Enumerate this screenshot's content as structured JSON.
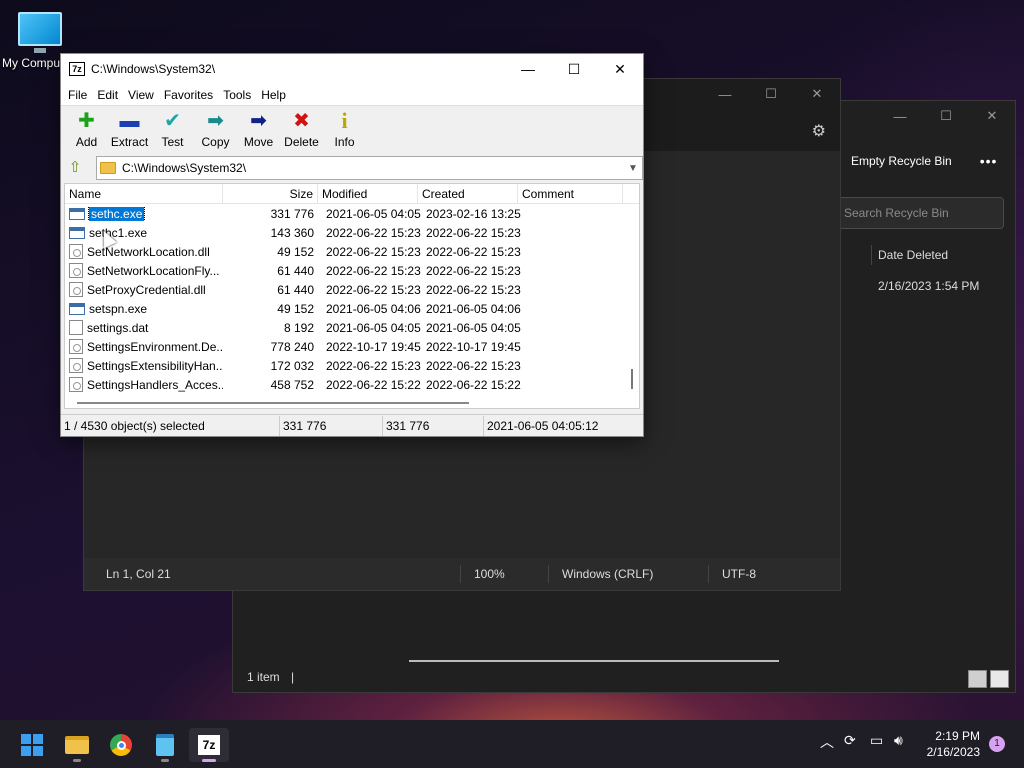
{
  "desktop": {
    "icon_label": "My Computer"
  },
  "recycle_bin": {
    "empty_label": "Empty Recycle Bin",
    "more_label": "•••",
    "search_placeholder": "Search Recycle Bin",
    "column_date_deleted": "Date Deleted",
    "date_value": "2/16/2023 1:54 PM",
    "status_items": "1 item"
  },
  "notepad": {
    "status": {
      "position": "Ln 1, Col 21",
      "zoom": "100%",
      "line_ending": "Windows (CRLF)",
      "encoding": "UTF-8"
    }
  },
  "zip": {
    "logo": "7z",
    "title": "C:\\Windows\\System32\\",
    "menu": [
      "File",
      "Edit",
      "View",
      "Favorites",
      "Tools",
      "Help"
    ],
    "toolbar": [
      {
        "label": "Add",
        "icon": "plus-icon",
        "glyph": "✚",
        "color": "#1aa31a"
      },
      {
        "label": "Extract",
        "icon": "minus-icon",
        "glyph": "▬",
        "color": "#1a3fb5"
      },
      {
        "label": "Test",
        "icon": "check-icon",
        "glyph": "✔",
        "color": "#1fa6a6"
      },
      {
        "label": "Copy",
        "icon": "arrow-right-teal-icon",
        "glyph": "➡",
        "color": "#1a8a8a"
      },
      {
        "label": "Move",
        "icon": "arrow-right-blue-icon",
        "glyph": "➡",
        "color": "#12208a"
      },
      {
        "label": "Delete",
        "icon": "x-icon",
        "glyph": "✖",
        "color": "#d01414"
      },
      {
        "label": "Info",
        "icon": "info-icon",
        "glyph": "i",
        "color": "#b8a800"
      }
    ],
    "address": "C:\\Windows\\System32\\",
    "columns": [
      "Name",
      "Size",
      "Modified",
      "Created",
      "Comment"
    ],
    "rows": [
      {
        "name": "sethc.exe",
        "type": "exe",
        "size": "331 776",
        "modified": "2021-06-05 04:05",
        "created": "2023-02-16 13:25",
        "selected": true
      },
      {
        "name": "sethc1.exe",
        "type": "exe",
        "size": "143 360",
        "modified": "2022-06-22 15:23",
        "created": "2022-06-22 15:23"
      },
      {
        "name": "SetNetworkLocation.dll",
        "type": "dll",
        "size": "49 152",
        "modified": "2022-06-22 15:23",
        "created": "2022-06-22 15:23"
      },
      {
        "name": "SetNetworkLocationFly...",
        "type": "dll",
        "size": "61 440",
        "modified": "2022-06-22 15:23",
        "created": "2022-06-22 15:23"
      },
      {
        "name": "SetProxyCredential.dll",
        "type": "dll",
        "size": "61 440",
        "modified": "2022-06-22 15:23",
        "created": "2022-06-22 15:23"
      },
      {
        "name": "setspn.exe",
        "type": "exe",
        "size": "49 152",
        "modified": "2021-06-05 04:06",
        "created": "2021-06-05 04:06"
      },
      {
        "name": "settings.dat",
        "type": "dat",
        "size": "8 192",
        "modified": "2021-06-05 04:05",
        "created": "2021-06-05 04:05"
      },
      {
        "name": "SettingsEnvironment.De...",
        "type": "dll",
        "size": "778 240",
        "modified": "2022-10-17 19:45",
        "created": "2022-10-17 19:45"
      },
      {
        "name": "SettingsExtensibilityHan...",
        "type": "dll",
        "size": "172 032",
        "modified": "2022-06-22 15:23",
        "created": "2022-06-22 15:23"
      },
      {
        "name": "SettingsHandlers_Acces...",
        "type": "dll",
        "size": "458 752",
        "modified": "2022-06-22 15:22",
        "created": "2022-06-22 15:22"
      }
    ],
    "status": {
      "selection": "1 / 4530 object(s) selected",
      "size": "331 776",
      "packed": "331 776",
      "modified": "2021-06-05 04:05:12"
    }
  },
  "taskbar": {
    "apps": [
      {
        "name": "start-button",
        "icon": "windows-logo-icon"
      },
      {
        "name": "file-explorer",
        "icon": "folder-icon"
      },
      {
        "name": "chrome",
        "icon": "chrome-icon"
      },
      {
        "name": "notepad",
        "icon": "notepad-icon"
      },
      {
        "name": "7zip",
        "icon": "7zip-icon",
        "active": true
      }
    ],
    "logo_7z": "7z",
    "time": "2:19 PM",
    "date": "2/16/2023",
    "notifications": "1"
  }
}
